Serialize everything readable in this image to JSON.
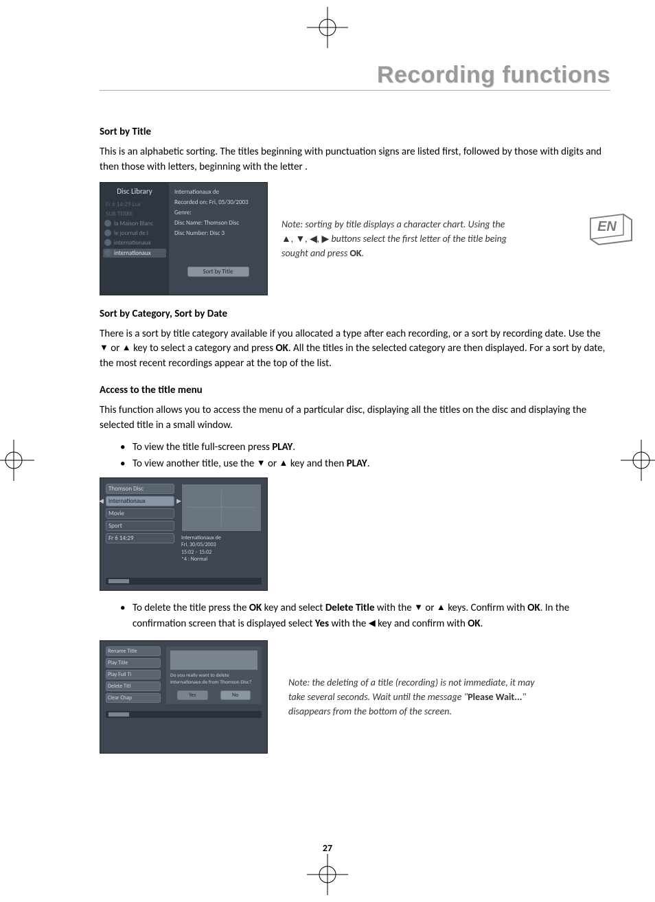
{
  "header": {
    "title": "Recording functions"
  },
  "lang_badge": "EN",
  "page_number": "27",
  "sec1": {
    "title": "Sort by Title",
    "body": "This is an alphabetic sorting. The titles beginning with punctuation signs are listed first, followed by those with digits and then those with letters, beginning with the letter ."
  },
  "shot1": {
    "lib_title": "Disc Library",
    "dim1": "Fr 6 14:29 Lux",
    "dim2": "SUR TERRE",
    "row1": "la Maison Blanc",
    "row2": "le journal de l",
    "row3": "internationaux",
    "row4_sel": "internationaux",
    "info_title": "Internationaux de",
    "info_rec": "Recorded on: Fri, 05/30/2003",
    "info_genre": "Genre:",
    "info_disc": "Disc Name:  Thomson Disc",
    "info_num": "Disc Number: Disc 3",
    "btn": "Sort by Title"
  },
  "note1": {
    "pre": "Note: sorting by title displays a character chart. Using the",
    "post": "buttons select the first letter of the title being sought and press",
    "ok": "OK",
    "end": "."
  },
  "sec2": {
    "title": "Sort by Category, Sort by Date",
    "body_a": "There is a sort by title category available if you allocated a type after each recording, or a sort by recording date. Use the ",
    "body_b": " or ",
    "body_c": " key to select a category and press ",
    "ok": "OK",
    "body_d": ". All the titles in the selected category are then displayed. For a sort by date, the most recent recordings appear at the top of the list."
  },
  "sec3": {
    "title": "Access to the title menu",
    "body": "This function allows you to access the menu of a particular disc, displaying all the titles on the disc and displaying the selected title in a small window.",
    "li1_a": "To view the title full-screen press ",
    "li1_b": "PLAY",
    "li1_c": ".",
    "li2_a": "To view another title, use the ",
    "li2_b": " or ",
    "li2_c": " key and then ",
    "li2_d": "PLAY",
    "li2_e": "."
  },
  "shot2": {
    "m0": "Thomson Disc",
    "m1": "Internationaux",
    "m2": "Movie",
    "m3": "Sport",
    "m4": "Fr 6 14:29",
    "meta1": "Internationaux de",
    "meta2": "Fri, 30/05/2003",
    "meta3": "15:02 – 15:02",
    "meta4": "*4 : Normal"
  },
  "sec4": {
    "li_a": "To delete the title press the ",
    "ok1": "OK",
    "li_b": " key and select ",
    "dt": "Delete Title",
    "li_c": " with the ",
    "li_d": " or ",
    "li_e": " keys. Confirm with ",
    "ok2": "OK",
    "li_f": ". In the confirmation screen that is displayed select ",
    "yes": "Yes",
    "li_g": " with the ",
    "li_h": " key and confirm with ",
    "ok3": "OK",
    "li_i": "."
  },
  "shot3": {
    "m0": "Rename Title",
    "m1": "Play Title",
    "m2": "Play Full Ti",
    "m3": "Delete Titl",
    "m4": "Clear Chap",
    "dlg": "Do you really want to delete Internationaux de from Thomson Disc?",
    "yes": "Yes",
    "no": "No"
  },
  "note2": {
    "a": "Note: the deleting of a title (recording) is not immediate, it may take several seconds. Wait until the message \"",
    "pw": "Please Wait...",
    "b": "\" disappears from the bottom of the screen."
  }
}
